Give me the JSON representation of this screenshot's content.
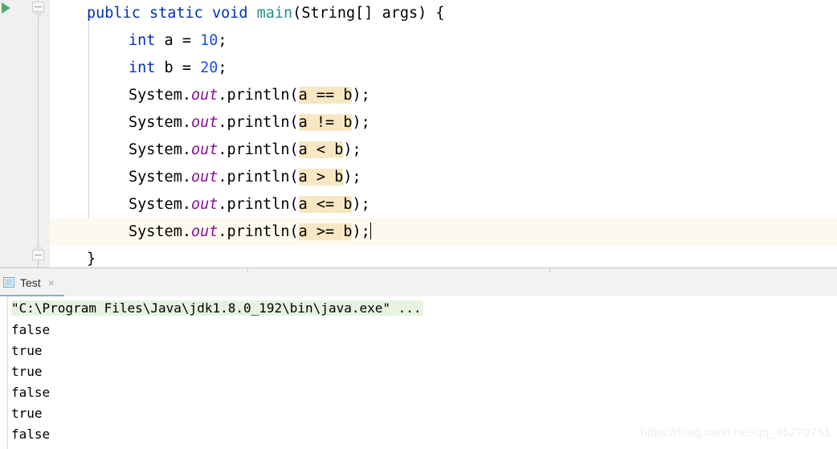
{
  "editor": {
    "language": "java",
    "gutter": {
      "run_marker": "run-gutter-icon",
      "fold_top": "fold-collapse-icon",
      "fold_bottom": "fold-collapse-icon"
    },
    "lines": [
      {
        "id": "line-method-signature",
        "indent": 0,
        "current": false,
        "tokens": [
          {
            "text": "public",
            "style": "kw"
          },
          {
            "text": " ",
            "style": "plain"
          },
          {
            "text": "static",
            "style": "kw"
          },
          {
            "text": " ",
            "style": "plain"
          },
          {
            "text": "void",
            "style": "kw"
          },
          {
            "text": " ",
            "style": "plain"
          },
          {
            "text": "main",
            "style": "cls"
          },
          {
            "text": "(String[] args) {",
            "style": "plain"
          }
        ]
      },
      {
        "id": "line-decl-a",
        "indent": 1,
        "current": false,
        "tokens": [
          {
            "text": "int",
            "style": "kw"
          },
          {
            "text": " a = ",
            "style": "plain"
          },
          {
            "text": "10",
            "style": "num"
          },
          {
            "text": ";",
            "style": "plain"
          }
        ]
      },
      {
        "id": "line-decl-b",
        "indent": 1,
        "current": false,
        "tokens": [
          {
            "text": "int",
            "style": "kw"
          },
          {
            "text": " b = ",
            "style": "plain"
          },
          {
            "text": "20",
            "style": "num"
          },
          {
            "text": ";",
            "style": "plain"
          }
        ]
      },
      {
        "id": "line-print-eq",
        "indent": 1,
        "current": false,
        "tokens": [
          {
            "text": "System.",
            "style": "plain"
          },
          {
            "text": "out",
            "style": "fld"
          },
          {
            "text": ".println(",
            "style": "plain"
          },
          {
            "text": "a == b",
            "style": "hl"
          },
          {
            "text": ");",
            "style": "plain"
          }
        ]
      },
      {
        "id": "line-print-neq",
        "indent": 1,
        "current": false,
        "tokens": [
          {
            "text": "System.",
            "style": "plain"
          },
          {
            "text": "out",
            "style": "fld"
          },
          {
            "text": ".println(",
            "style": "plain"
          },
          {
            "text": "a != b",
            "style": "hl"
          },
          {
            "text": ");",
            "style": "plain"
          }
        ]
      },
      {
        "id": "line-print-lt",
        "indent": 1,
        "current": false,
        "tokens": [
          {
            "text": "System.",
            "style": "plain"
          },
          {
            "text": "out",
            "style": "fld"
          },
          {
            "text": ".println(",
            "style": "plain"
          },
          {
            "text": "a < b",
            "style": "hl"
          },
          {
            "text": ");",
            "style": "plain"
          }
        ]
      },
      {
        "id": "line-print-gt",
        "indent": 1,
        "current": false,
        "tokens": [
          {
            "text": "System.",
            "style": "plain"
          },
          {
            "text": "out",
            "style": "fld"
          },
          {
            "text": ".println(",
            "style": "plain"
          },
          {
            "text": "a > b",
            "style": "hl"
          },
          {
            "text": ");",
            "style": "plain"
          }
        ]
      },
      {
        "id": "line-print-lte",
        "indent": 1,
        "current": false,
        "tokens": [
          {
            "text": "System.",
            "style": "plain"
          },
          {
            "text": "out",
            "style": "fld"
          },
          {
            "text": ".println(",
            "style": "plain"
          },
          {
            "text": "a <= b",
            "style": "hl"
          },
          {
            "text": ");",
            "style": "plain"
          }
        ]
      },
      {
        "id": "line-print-gte",
        "indent": 1,
        "current": true,
        "caret": true,
        "tokens": [
          {
            "text": "System.",
            "style": "plain"
          },
          {
            "text": "out",
            "style": "fld"
          },
          {
            "text": ".println(",
            "style": "plain"
          },
          {
            "text": "a >= b",
            "style": "hl"
          },
          {
            "text": ");",
            "style": "plain"
          }
        ]
      },
      {
        "id": "line-close-brace",
        "indent": 0,
        "current": false,
        "tokens": [
          {
            "text": "}",
            "style": "plain"
          }
        ]
      }
    ],
    "colors": {
      "keyword": "#0033b3",
      "number": "#1750eb",
      "class_name": "#248f8f",
      "static_field": "#871094",
      "search_highlight": "#f7e8c3",
      "current_line": "#fcfaef",
      "gutter_bg": "#f0f0f0",
      "run_marker": "#59a869"
    }
  },
  "toolwindow": {
    "tabs": [
      {
        "id": "tab-test",
        "label": "Test",
        "icon": "console-icon",
        "close": "×",
        "active": true
      }
    ],
    "console": {
      "command_line": "\"C:\\Program Files\\Java\\jdk1.8.0_192\\bin\\java.exe\" ...",
      "output": [
        "false",
        "true",
        "true",
        "false",
        "true",
        "false"
      ],
      "command_bg": "#e7f2e0"
    }
  },
  "watermark": {
    "text": "https://blog.csdn.net/qq_45270751"
  }
}
